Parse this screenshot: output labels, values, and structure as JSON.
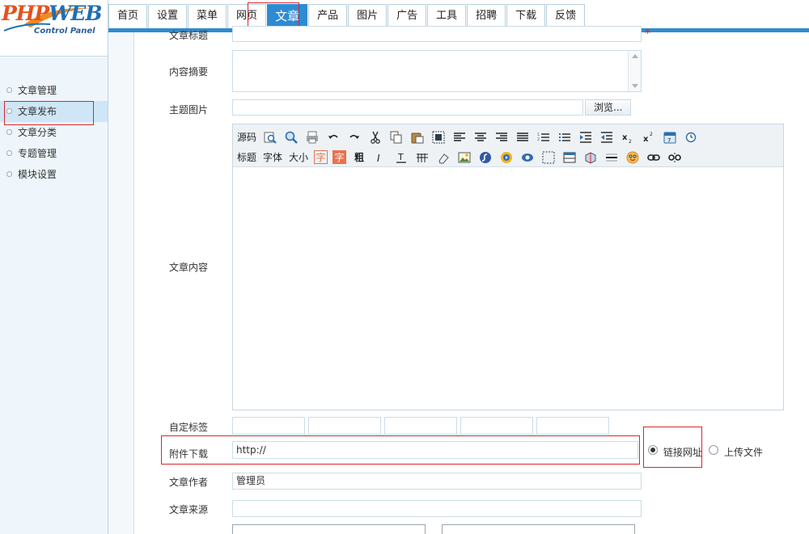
{
  "logo": {
    "brand_left": "PHP",
    "brand_right": "WEB",
    "subtitle": "Control Panel"
  },
  "sidebar": {
    "items": [
      {
        "label": "文章管理"
      },
      {
        "label": "文章发布"
      },
      {
        "label": "文章分类"
      },
      {
        "label": "专题管理"
      },
      {
        "label": "模块设置"
      }
    ],
    "active_index": 1
  },
  "tabs": [
    {
      "label": "首页"
    },
    {
      "label": "设置"
    },
    {
      "label": "菜单"
    },
    {
      "label": "网页"
    },
    {
      "label": "文章"
    },
    {
      "label": "产品"
    },
    {
      "label": "图片"
    },
    {
      "label": "广告"
    },
    {
      "label": "工具"
    },
    {
      "label": "招聘"
    },
    {
      "label": "下载"
    },
    {
      "label": "反馈"
    }
  ],
  "active_tab": "文章",
  "form": {
    "title_label": "文章标题",
    "required_mark": "*",
    "summary_label": "内容摘要",
    "image_label": "主题图片",
    "browse_label": "浏览...",
    "content_label": "文章内容",
    "tags_label": "自定标签",
    "attachment_label": "附件下载",
    "attachment_value": "http://",
    "radio_link_label": "链接网址",
    "radio_upload_label": "上传文件",
    "author_label": "文章作者",
    "author_value": "管理员",
    "source_label": "文章来源"
  },
  "editor": {
    "toolbar_row1": [
      "源码",
      "preview-icon",
      "find-icon",
      "print-icon",
      "undo-icon",
      "redo-icon",
      "cut-icon",
      "copy-icon",
      "paste-icon",
      "select-all-icon",
      "align-left-icon",
      "align-center-icon",
      "align-right-icon",
      "align-justify-icon",
      "ordered-list-icon",
      "unordered-list-icon",
      "indent-icon",
      "outdent-icon",
      "subscript-icon",
      "superscript-icon",
      "date-icon",
      "time-icon"
    ],
    "toolbar_row2": [
      "标题",
      "字体",
      "大小",
      "字",
      "字",
      "粗",
      "italic-icon",
      "underline-icon",
      "strike-icon",
      "eraser-icon",
      "image-icon",
      "flash-icon",
      "media-icon",
      "realplayer-icon",
      "layer-icon",
      "table-icon",
      "special-char-icon",
      "hr-icon",
      "emoticon-icon",
      "link-icon",
      "unlink-icon"
    ]
  },
  "colors": {
    "accent": "#2f8bd1",
    "highlight_box": "#d9262b",
    "sidebar_bg": "#eef6fb"
  }
}
